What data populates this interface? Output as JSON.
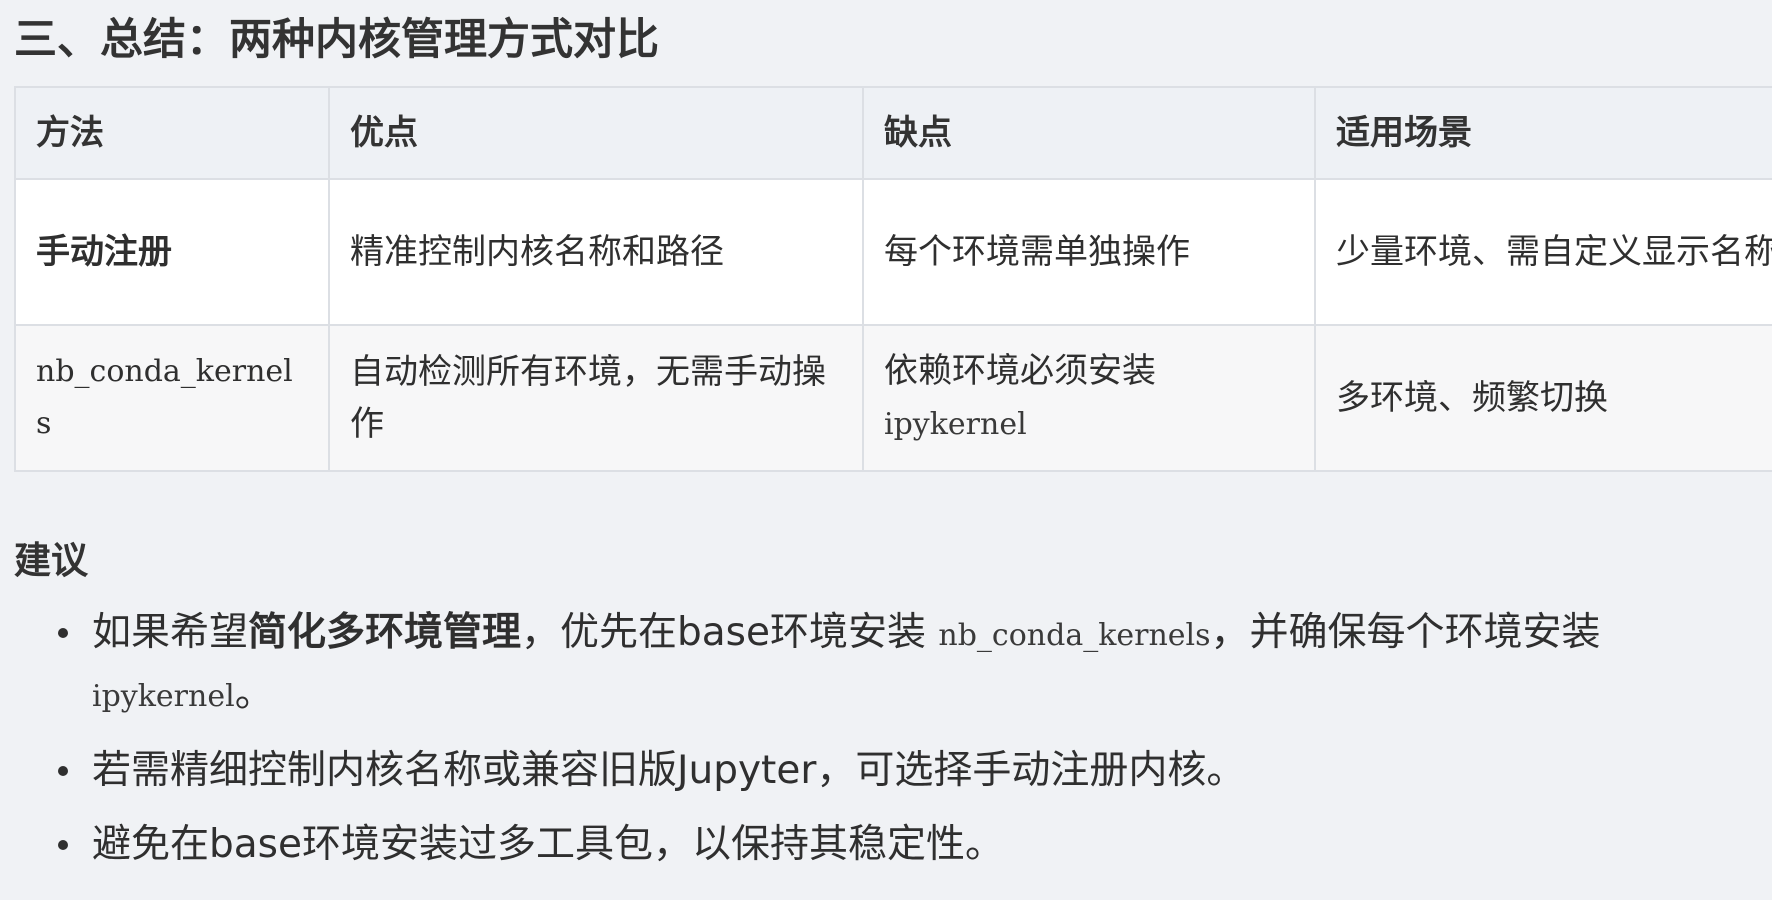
{
  "title": "三、总结：两种内核管理方式对比",
  "table": {
    "headers": [
      "方法",
      "优点",
      "缺点",
      "适用场景"
    ],
    "rows": [
      {
        "method": "手动注册",
        "pros": "精准控制内核名称和路径",
        "cons": "每个环境需单独操作",
        "scenario": "少量环境、需自定义显示名称"
      },
      {
        "method": "nb_conda_kernels",
        "pros": "自动检测所有环境，无需手动操作",
        "cons_text": "依赖环境必须安装",
        "cons_code": "ipykernel",
        "scenario": "多环境、频繁切换"
      }
    ]
  },
  "advice": {
    "heading": "建议",
    "items": [
      {
        "pre": "如果希望",
        "bold": "简化多环境管理",
        "mid": "，优先在base环境安装 ",
        "code1": "nb_conda_kernels",
        "mid2": "，并确保每个环境安装 ",
        "code2": "ipykernel",
        "post": "。"
      },
      {
        "text": "若需精细控制内核名称或兼容旧版Jupyter，可选择手动注册内核。"
      },
      {
        "text": "避免在base环境安装过多工具包，以保持其稳定性。"
      }
    ]
  }
}
